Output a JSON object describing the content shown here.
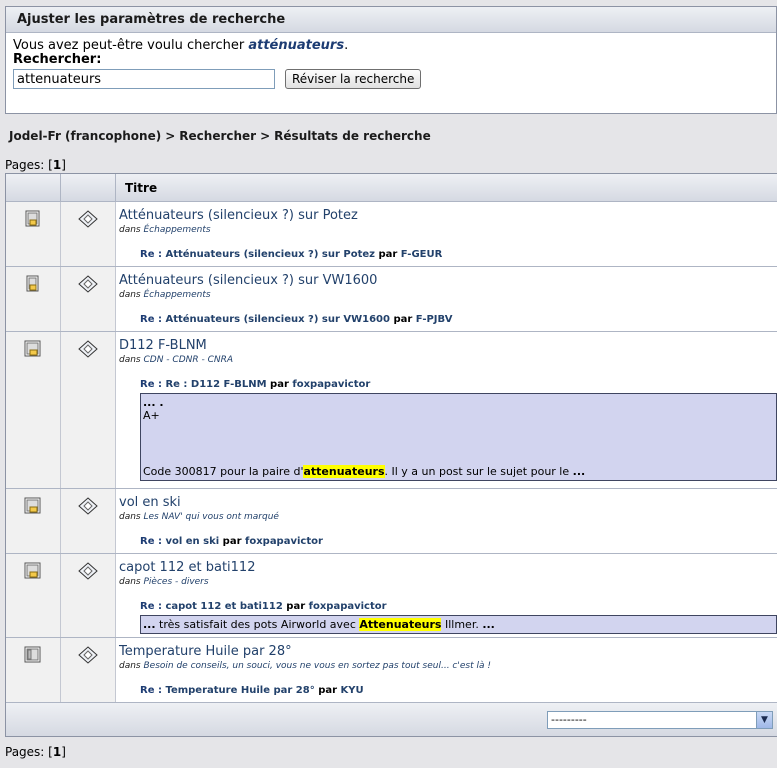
{
  "adjust": {
    "heading": "Ajuster les paramètres de recherche",
    "suggest_prefix": "Vous avez peut-être voulu chercher ",
    "suggest_term": "atténuateurs",
    "suggest_suffix": ".",
    "search_label": "Rechercher:",
    "search_value": "attenuateurs",
    "revise_button": "Réviser la recherche"
  },
  "breadcrumb": {
    "items": [
      "Jodel-Fr (francophone)",
      "Rechercher",
      "Résultats de recherche"
    ],
    "separator": ">"
  },
  "pages": {
    "label": "Pages: ",
    "current": "1"
  },
  "table": {
    "header_title": "Titre",
    "in_label": "dans",
    "by_label": "par",
    "reply_prefix": "Re :",
    "rows": [
      {
        "title": "Atténuateurs (silencieux ?) sur Potez",
        "board": "Échappements",
        "reply_title": "Atténuateurs (silencieux ?) sur Potez",
        "reply_author": "F-GEUR"
      },
      {
        "title": "Atténuateurs (silencieux ?) sur VW1600",
        "board": "Échappements",
        "reply_title": "Atténuateurs (silencieux ?) sur VW1600",
        "reply_author": "F-PJBV"
      },
      {
        "title": "D112 F-BLNM",
        "board": "CDN - CDNR - CNRA",
        "reply_title": "Re : D112 F-BLNM",
        "reply_author": "foxpapavictor",
        "snippet_line1": "... .",
        "snippet_line2": "A+",
        "snippet_before": "Code 300817 pour la paire d'",
        "snippet_hl": "attenuateurs",
        "snippet_after": ". Il y a un post sur le sujet pour le ",
        "snippet_end": "..."
      },
      {
        "title": "vol en ski",
        "board": "Les NAV' qui vous ont marqué",
        "reply_title": "vol en ski",
        "reply_author": "foxpapavictor"
      },
      {
        "title": "capot 112 et bati112",
        "board": "Pièces - divers",
        "reply_title": "capot 112 et bati112",
        "reply_author": "foxpapavictor",
        "snippet_start": "...",
        "snippet_before": " très satisfait des pots Airworld avec ",
        "snippet_hl": "Attenuateurs",
        "snippet_after": " Illmer. ",
        "snippet_end": "..."
      },
      {
        "title": "Temperature Huile par 28°",
        "board": "Besoin de conseils, un souci, vous ne vous en sortez pas tout seul... c'est là !",
        "reply_title": "Temperature Huile par 28°",
        "reply_author": "KYU"
      }
    ]
  },
  "jump": {
    "selected": "---------"
  },
  "icons": {
    "topic_icon": "document-pages-icon",
    "message_icon": "xx-diamond-icon"
  }
}
